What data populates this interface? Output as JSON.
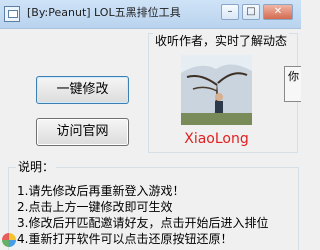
{
  "window": {
    "title": "[By:Peanut] LOL五黑排位工具",
    "minimize_glyph": "–",
    "maximize_glyph": "□",
    "close_glyph": "✕"
  },
  "actions": {
    "modify_label": "一键修改",
    "website_label": "访问官网"
  },
  "follow": {
    "label": "收听作者，实时了解动态",
    "author_name": "XiaoLong"
  },
  "side_tab": {
    "label": "你"
  },
  "notes": {
    "label": "说明：",
    "items": [
      "1.请先修改后再重新登入游戏！",
      "2.点击上方一键修改即可生效",
      "3.修改后开匹配邀请好友，点击开始后进入排位",
      "4.重新打开软件可以点击还原按钮还原！"
    ]
  },
  "colors": {
    "author_name": "#e02020",
    "titlebar": "#b9d3ee"
  }
}
